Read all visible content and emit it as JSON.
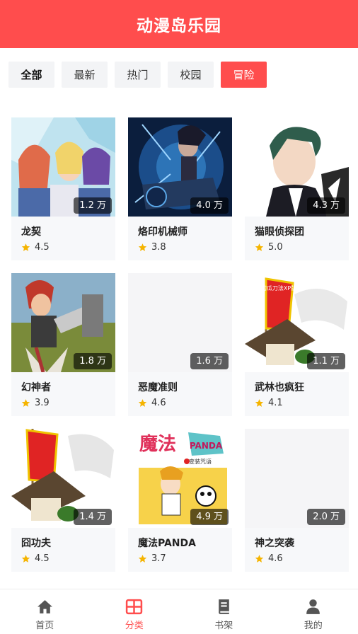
{
  "header": {
    "title": "动漫岛乐园"
  },
  "tabs": [
    {
      "label": "全部"
    },
    {
      "label": "最新"
    },
    {
      "label": "热门"
    },
    {
      "label": "校园"
    },
    {
      "label": "冒险"
    }
  ],
  "comics": [
    {
      "title": "龙契",
      "views": "1.2 万",
      "rating": "4.5"
    },
    {
      "title": "烙印机械师",
      "views": "4.0 万",
      "rating": "3.8"
    },
    {
      "title": "猫眼侦探团",
      "views": "4.3 万",
      "rating": "5.0"
    },
    {
      "title": "幻神者",
      "views": "1.8 万",
      "rating": "3.9"
    },
    {
      "title": "恶魔准则",
      "views": "1.6 万",
      "rating": "4.6"
    },
    {
      "title": "武林也疯狂",
      "views": "1.1 万",
      "rating": "4.1"
    },
    {
      "title": "囧功夫",
      "views": "1.4 万",
      "rating": "4.5"
    },
    {
      "title": "魔法PANDA",
      "views": "4.9 万",
      "rating": "3.7"
    },
    {
      "title": "神之突袭",
      "views": "2.0 万",
      "rating": "4.6"
    }
  ],
  "covers": {
    "c5_banner": "切瓜刀法XP版",
    "c8_logo": "魔法",
    "c8_logo_sub": "PANDA",
    "c8_caption": "变装咒语"
  },
  "nav": [
    {
      "label": "首页",
      "icon": "home-icon"
    },
    {
      "label": "分类",
      "icon": "category-grid-icon"
    },
    {
      "label": "书架",
      "icon": "bookshelf-icon"
    },
    {
      "label": "我的",
      "icon": "user-icon"
    }
  ],
  "colors": {
    "accent": "#ff4d4d",
    "tab_bg": "#f3f4f6",
    "card_bg": "#f7f8fa",
    "star": "#f5b400"
  }
}
